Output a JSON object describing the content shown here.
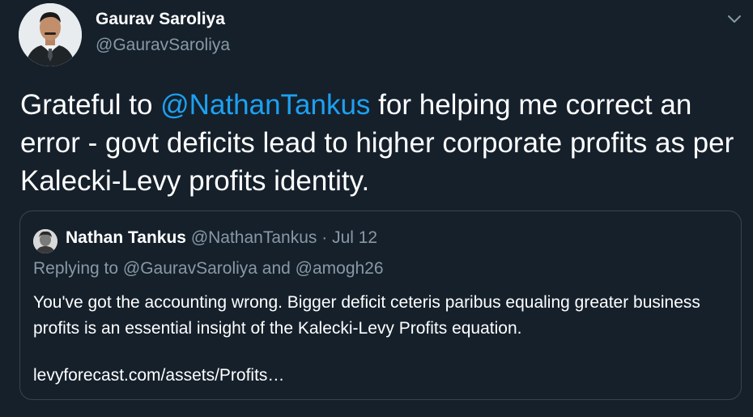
{
  "author": {
    "name": "Gaurav Saroliya",
    "handle": "@GauravSaroliya"
  },
  "tweet": {
    "text_before": "Grateful to ",
    "mention": "@NathanTankus",
    "text_after": " for helping me correct an error - govt deficits lead to higher corporate profits as per Kalecki-Levy profits identity."
  },
  "quoted": {
    "name": "Nathan Tankus",
    "handle": "@NathanTankus",
    "separator": " · ",
    "date": "Jul 12",
    "reply_to": "Replying to @GauravSaroliya and @amogh26",
    "body": "You've got the accounting wrong. Bigger deficit ceteris paribus equaling greater business profits is an essential insight of the Kalecki-Levy Profits equation.",
    "link": "levyforecast.com/assets/Profits…"
  },
  "icons": {
    "menu": "chevron-down-icon"
  },
  "colors": {
    "background": "#15202b",
    "accent": "#1da1f2",
    "secondary_text": "#8899a6",
    "border": "#38444d"
  }
}
